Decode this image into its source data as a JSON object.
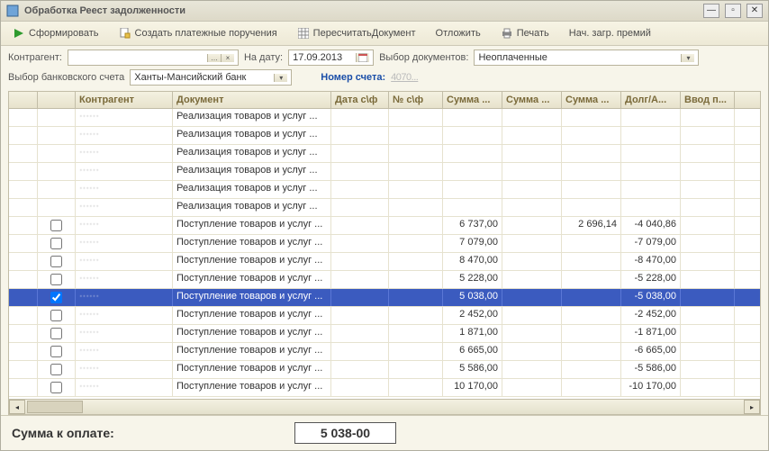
{
  "window": {
    "title": "Обработка  Реест задолженности"
  },
  "toolbar": {
    "form": "Сформировать",
    "create_payments": "Создать платежные поручения",
    "recalc_doc": "ПересчитатьДокумент",
    "postpone": "Отложить",
    "print": "Печать",
    "load_premium": "Нач. загр. премий"
  },
  "filters": {
    "counterparty_label": "Контрагент:",
    "counterparty_value": "",
    "date_label": "На дату:",
    "date_value": "17.09.2013",
    "doc_select_label": "Выбор документов:",
    "doc_select_value": "Неоплаченные",
    "bank_label": "Выбор банковского счета",
    "bank_value": "Ханты-Мансийский банк",
    "account_label": "Номер счета:",
    "account_value": "4070..."
  },
  "columns": {
    "c0": "",
    "c1": "",
    "c2": "Контрагент",
    "c3": "Документ",
    "c4": "Дата с\\ф",
    "c5": "№ с\\ф",
    "c6": "Сумма ...",
    "c7": "Сумма ...",
    "c8": "Сумма ...",
    "c9": "Долг/А...",
    "c10": "Ввод п..."
  },
  "rows": [
    {
      "chk": null,
      "kontr": "······",
      "doc": "Реализация товаров и услуг ...",
      "sum1": "",
      "sum2": "",
      "sum3": "",
      "debt": "",
      "sel": false
    },
    {
      "chk": null,
      "kontr": "······",
      "doc": "Реализация товаров и услуг ...",
      "sum1": "",
      "sum2": "",
      "sum3": "",
      "debt": "",
      "sel": false
    },
    {
      "chk": null,
      "kontr": "······",
      "doc": "Реализация товаров и услуг ...",
      "sum1": "",
      "sum2": "",
      "sum3": "",
      "debt": "",
      "sel": false
    },
    {
      "chk": null,
      "kontr": "······",
      "doc": "Реализация товаров и услуг ...",
      "sum1": "",
      "sum2": "",
      "sum3": "",
      "debt": "",
      "sel": false
    },
    {
      "chk": null,
      "kontr": "······",
      "doc": "Реализация товаров и услуг ...",
      "sum1": "",
      "sum2": "",
      "sum3": "",
      "debt": "",
      "sel": false
    },
    {
      "chk": null,
      "kontr": "······",
      "doc": "Реализация товаров и услуг ...",
      "sum1": "",
      "sum2": "",
      "sum3": "",
      "debt": "",
      "sel": false
    },
    {
      "chk": false,
      "kontr": "······",
      "doc": "Поступление товаров и услуг ...",
      "sum1": "6 737,00",
      "sum2": "",
      "sum3": "2 696,14",
      "debt": "-4 040,86",
      "sel": false
    },
    {
      "chk": false,
      "kontr": "······",
      "doc": "Поступление товаров и услуг ...",
      "sum1": "7 079,00",
      "sum2": "",
      "sum3": "",
      "debt": "-7 079,00",
      "sel": false
    },
    {
      "chk": false,
      "kontr": "······",
      "doc": "Поступление товаров и услуг ...",
      "sum1": "8 470,00",
      "sum2": "",
      "sum3": "",
      "debt": "-8 470,00",
      "sel": false
    },
    {
      "chk": false,
      "kontr": "······",
      "doc": "Поступление товаров и услуг ...",
      "sum1": "5 228,00",
      "sum2": "",
      "sum3": "",
      "debt": "-5 228,00",
      "sel": false
    },
    {
      "chk": true,
      "kontr": "······",
      "doc": "Поступление товаров и услуг ...",
      "sum1": "5 038,00",
      "sum2": "",
      "sum3": "",
      "debt": "-5 038,00",
      "sel": true
    },
    {
      "chk": false,
      "kontr": "······",
      "doc": "Поступление товаров и услуг ...",
      "sum1": "2 452,00",
      "sum2": "",
      "sum3": "",
      "debt": "-2 452,00",
      "sel": false
    },
    {
      "chk": false,
      "kontr": "······",
      "doc": "Поступление товаров и услуг ...",
      "sum1": "1 871,00",
      "sum2": "",
      "sum3": "",
      "debt": "-1 871,00",
      "sel": false
    },
    {
      "chk": false,
      "kontr": "······",
      "doc": "Поступление товаров и услуг ...",
      "sum1": "6 665,00",
      "sum2": "",
      "sum3": "",
      "debt": "-6 665,00",
      "sel": false
    },
    {
      "chk": false,
      "kontr": "······",
      "doc": "Поступление товаров и услуг ...",
      "sum1": "5 586,00",
      "sum2": "",
      "sum3": "",
      "debt": "-5 586,00",
      "sel": false
    },
    {
      "chk": false,
      "kontr": "······",
      "doc": "Поступление товаров и услуг ...",
      "sum1": "10 170,00",
      "sum2": "",
      "sum3": "",
      "debt": "-10 170,00",
      "sel": false
    }
  ],
  "footer": {
    "label": "Сумма к оплате:",
    "value": "5 038-00"
  }
}
